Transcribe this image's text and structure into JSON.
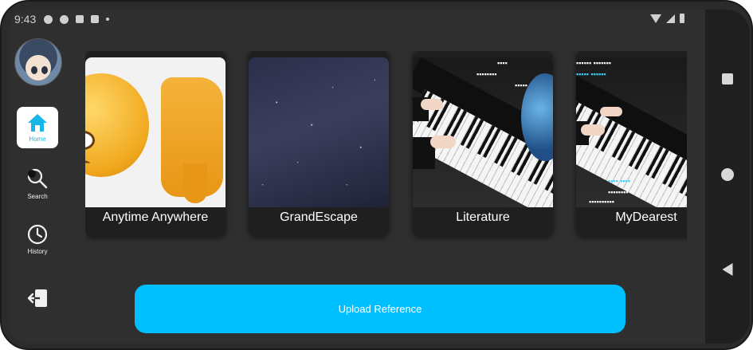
{
  "status_bar": {
    "time": "9:43"
  },
  "sidebar": {
    "items": [
      {
        "label": "Home",
        "active": true
      },
      {
        "label": "Search",
        "active": false
      },
      {
        "label": "History",
        "active": false
      }
    ]
  },
  "cards": [
    {
      "title": "Anytime Anywhere"
    },
    {
      "title": "GrandEscape"
    },
    {
      "title": "Literature"
    },
    {
      "title": "MyDearest"
    }
  ],
  "upload_label": "Upload Reference",
  "colors": {
    "accent": "#00BFFF",
    "background": "#2F2F2F",
    "card": "#1F1F1F"
  }
}
